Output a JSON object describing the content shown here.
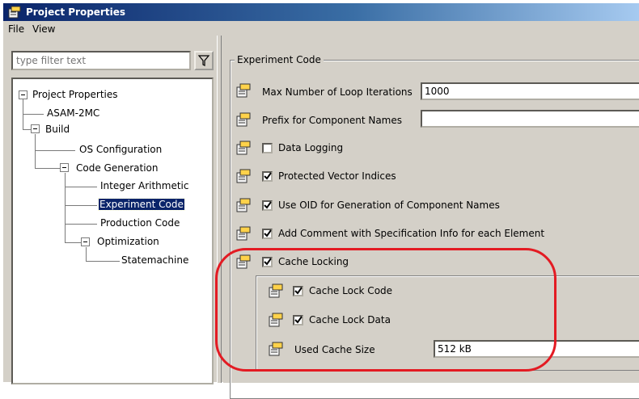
{
  "window": {
    "title": "Project Properties"
  },
  "menu": {
    "items": [
      "File",
      "View"
    ]
  },
  "filter": {
    "placeholder": "type filter text"
  },
  "tree": {
    "root": "Project Properties",
    "asam": "ASAM-2MC",
    "build": "Build",
    "os_config": "OS Configuration",
    "code_gen": "Code Generation",
    "integer_arith": "Integer Arithmetic",
    "experiment_code": "Experiment Code",
    "production_code": "Production Code",
    "optimization": "Optimization",
    "statemachine": "Statemachine"
  },
  "panel": {
    "group_title": "Experiment Code",
    "max_loop_label": "Max Number of Loop Iterations",
    "max_loop_value": "1000",
    "prefix_label": "Prefix for Component Names",
    "prefix_value": "",
    "data_logging": {
      "label": "Data Logging",
      "checked": false
    },
    "protected_vec": {
      "label": "Protected Vector Indices",
      "checked": true
    },
    "use_oid": {
      "label": "Use OID for Generation of Component Names",
      "checked": true
    },
    "add_comment": {
      "label": "Add Comment with Specification Info for each Element",
      "checked": true
    },
    "cache_locking": {
      "label": "Cache Locking",
      "checked": true
    },
    "cache_lock_code": {
      "label": "Cache Lock Code",
      "checked": true
    },
    "cache_lock_data": {
      "label": "Cache Lock Data",
      "checked": true
    },
    "used_cache_label": "Used Cache Size",
    "used_cache_value": "512 kB"
  },
  "colors": {
    "title_start": "#0a246a",
    "title_end": "#a6caf0",
    "highlight": "#e31b23",
    "selection": "#0a246a"
  },
  "icons": [
    "properties-icon",
    "filter-icon",
    "check-icon"
  ]
}
